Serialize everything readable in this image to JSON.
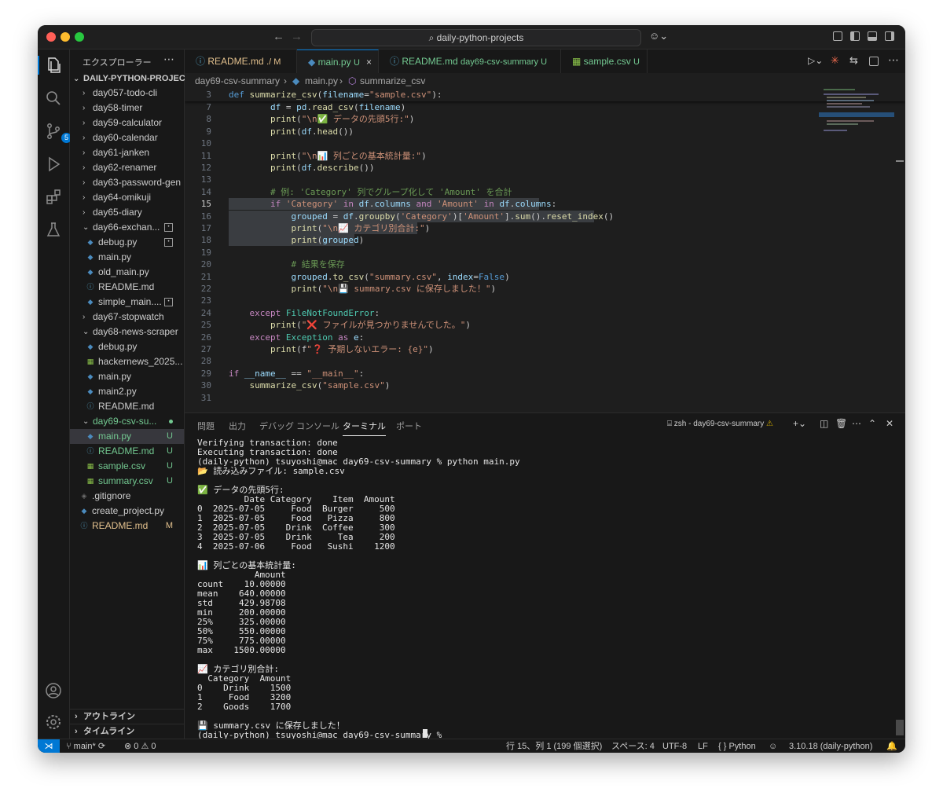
{
  "titlebar": {
    "search_text": "daily-python-projects"
  },
  "activity": {
    "scm_badge": "5"
  },
  "sidebar": {
    "title": "エクスプローラー",
    "root": "DAILY-PYTHON-PROJEC...",
    "items": [
      {
        "label": "day057-todo-cli"
      },
      {
        "label": "day58-timer"
      },
      {
        "label": "day59-calculator"
      },
      {
        "label": "day60-calendar"
      },
      {
        "label": "day61-janken"
      },
      {
        "label": "day62-renamer"
      },
      {
        "label": "day63-password-gen"
      },
      {
        "label": "day64-omikuji"
      },
      {
        "label": "day65-diary"
      },
      {
        "label": "day66-exchan..."
      },
      {
        "label": "debug.py"
      },
      {
        "label": "main.py"
      },
      {
        "label": "old_main.py"
      },
      {
        "label": "README.md"
      },
      {
        "label": "simple_main...."
      },
      {
        "label": "day67-stopwatch"
      },
      {
        "label": "day68-news-scraper"
      },
      {
        "label": "debug.py"
      },
      {
        "label": "hackernews_2025..."
      },
      {
        "label": "main.py"
      },
      {
        "label": "main2.py"
      },
      {
        "label": "README.md"
      },
      {
        "label": "day69-csv-su..."
      },
      {
        "label": "main.py",
        "status": "U"
      },
      {
        "label": "README.md",
        "status": "U"
      },
      {
        "label": "sample.csv",
        "status": "U"
      },
      {
        "label": "summary.csv",
        "status": "U"
      },
      {
        "label": ".gitignore"
      },
      {
        "label": "create_project.py"
      },
      {
        "label": "README.md",
        "status": "M"
      }
    ],
    "outline": "アウトライン",
    "timeline": "タイムライン"
  },
  "tabs": [
    {
      "name": "README.md",
      "meta": "./ M"
    },
    {
      "name": "main.py",
      "meta": "U"
    },
    {
      "name": "README.md",
      "meta": "day69-csv-summary U"
    },
    {
      "name": "sample.csv",
      "meta": "U"
    }
  ],
  "breadcrumb": {
    "folder": "day69-csv-summary",
    "file": "main.py",
    "symbol": "summarize_csv"
  },
  "editor": {
    "sticky_line": "3",
    "sticky_code": "def summarize_csv(filename=\"sample.csv\"):",
    "lines": [
      {
        "n": "7",
        "code": "        df = pd.read_csv(filename)"
      },
      {
        "n": "8",
        "code": "        print(\"\\n✅ データの先頭5行:\")"
      },
      {
        "n": "9",
        "code": "        print(df.head())"
      },
      {
        "n": "10",
        "code": ""
      },
      {
        "n": "11",
        "code": "        print(\"\\n📊 列ごとの基本統計量:\")"
      },
      {
        "n": "12",
        "code": "        print(df.describe())"
      },
      {
        "n": "13",
        "code": ""
      },
      {
        "n": "14",
        "code": "        # 例: 'Category' 列でグループ化して 'Amount' を合計"
      },
      {
        "n": "15",
        "code": "        if 'Category' in df.columns and 'Amount' in df.columns:"
      },
      {
        "n": "16",
        "code": "            grouped = df.groupby('Category')['Amount'].sum().reset_index()"
      },
      {
        "n": "17",
        "code": "            print(\"\\n📈 カテゴリ別合計:\")"
      },
      {
        "n": "18",
        "code": "            print(grouped)"
      },
      {
        "n": "19",
        "code": ""
      },
      {
        "n": "20",
        "code": "            # 結果を保存"
      },
      {
        "n": "21",
        "code": "            grouped.to_csv(\"summary.csv\", index=False)"
      },
      {
        "n": "22",
        "code": "            print(\"\\n💾 summary.csv に保存しました！\")"
      },
      {
        "n": "23",
        "code": ""
      },
      {
        "n": "24",
        "code": "    except FileNotFoundError:"
      },
      {
        "n": "25",
        "code": "        print(\"❌ ファイルが見つかりませんでした。\")"
      },
      {
        "n": "26",
        "code": "    except Exception as e:"
      },
      {
        "n": "27",
        "code": "        print(f\"❓ 予期しないエラー: {e}\")"
      },
      {
        "n": "28",
        "code": ""
      },
      {
        "n": "29",
        "code": "if __name__ == \"__main__\":"
      },
      {
        "n": "30",
        "code": "    summarize_csv(\"sample.csv\")"
      },
      {
        "n": "31",
        "code": ""
      }
    ]
  },
  "panel": {
    "tabs": [
      "問題",
      "出力",
      "デバッグ コンソール",
      "ターミナル",
      "ポート"
    ],
    "terminal_name": "zsh - day69-csv-summary",
    "terminal_text": "Verifying transaction: done\nExecuting transaction: done\n(daily-python) tsuyoshi@mac day69-csv-summary % python main.py\n📂 読み込みファイル: sample.csv\n\n✅ データの先頭5行:\n         Date Category    Item  Amount\n0  2025-07-05     Food  Burger     500\n1  2025-07-05     Food   Pizza     800\n2  2025-07-05    Drink  Coffee     300\n3  2025-07-05    Drink     Tea     200\n4  2025-07-06     Food   Sushi    1200\n\n📊 列ごとの基本統計量:\n           Amount\ncount    10.00000\nmean    640.00000\nstd     429.98708\nmin     200.00000\n25%     325.00000\n50%     550.00000\n75%     775.00000\nmax    1500.00000\n\n📈 カテゴリ別合計:\n  Category  Amount\n0    Drink    1500\n1     Food    3200\n2    Goods    1700\n\n💾 summary.csv に保存しました！\n(daily-python) tsuyoshi@mac day69-csv-summary % "
  },
  "status": {
    "branch": "main*",
    "errors": "0",
    "warnings": "0",
    "position": "行 15、列 1 (199 個選択)",
    "spaces": "スペース: 4",
    "encoding": "UTF-8",
    "eol": "LF",
    "language": "Python",
    "interpreter": "3.10.18 (daily-python)"
  }
}
